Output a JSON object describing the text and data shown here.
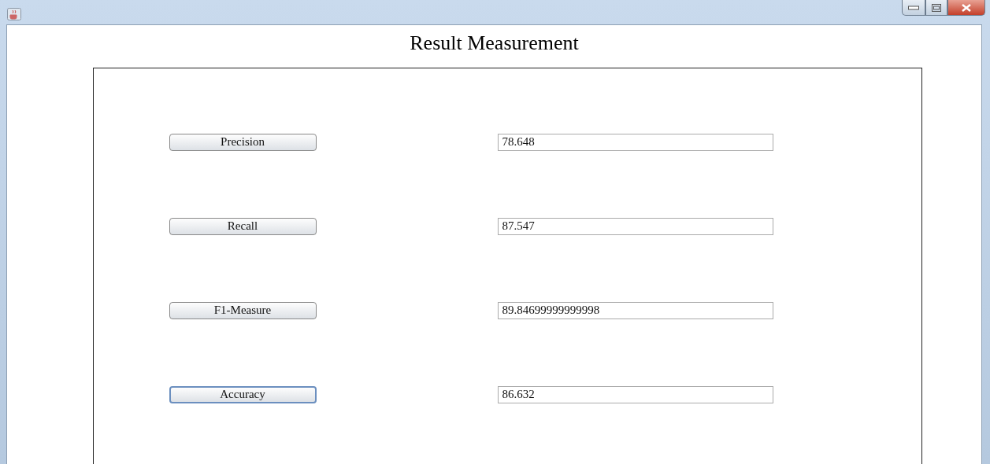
{
  "window": {
    "title": "Result Measurement"
  },
  "rows": [
    {
      "label": "Precision",
      "value": "78.648",
      "focused": false
    },
    {
      "label": "Recall",
      "value": "87.547",
      "focused": false
    },
    {
      "label": "F1-Measure",
      "value": "89.84699999999998",
      "focused": false
    },
    {
      "label": "Accuracy",
      "value": "86.632",
      "focused": true
    }
  ]
}
